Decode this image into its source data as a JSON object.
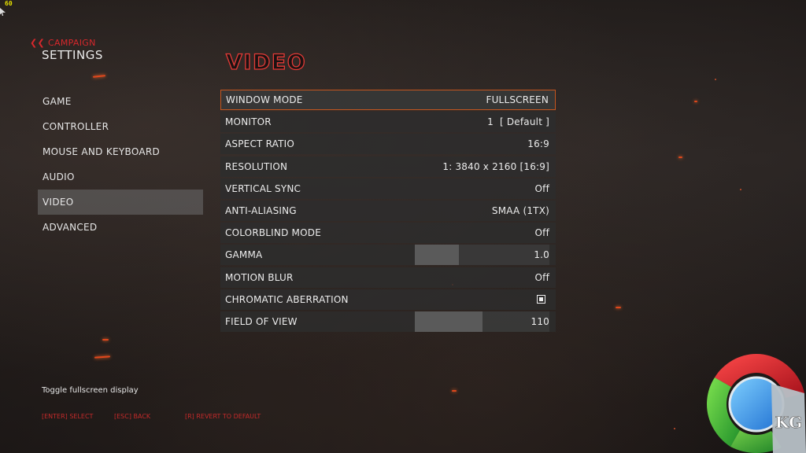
{
  "hud": {
    "fps": "60"
  },
  "header": {
    "back_label": "CAMPAIGN",
    "section_title": "SETTINGS",
    "page_title": "VIDEO"
  },
  "sidebar": {
    "items": [
      {
        "label": "GAME",
        "active": false
      },
      {
        "label": "CONTROLLER",
        "active": false
      },
      {
        "label": "MOUSE AND KEYBOARD",
        "active": false
      },
      {
        "label": "AUDIO",
        "active": false
      },
      {
        "label": "VIDEO",
        "active": true
      },
      {
        "label": "ADVANCED",
        "active": false
      }
    ]
  },
  "settings": [
    {
      "label": "WINDOW MODE",
      "value": "FULLSCREEN",
      "type": "select",
      "selected": true
    },
    {
      "label": "MONITOR",
      "value": "1  [ Default ]",
      "type": "select"
    },
    {
      "label": "ASPECT RATIO",
      "value": "16:9",
      "type": "select"
    },
    {
      "label": "RESOLUTION",
      "value": "1: 3840 x 2160 [16:9]",
      "type": "select"
    },
    {
      "label": "VERTICAL SYNC",
      "value": "Off",
      "type": "select"
    },
    {
      "label": "ANTI-ALIASING",
      "value": "SMAA (1TX)",
      "type": "select"
    },
    {
      "label": "COLORBLIND MODE",
      "value": "Off",
      "type": "select"
    },
    {
      "label": "GAMMA",
      "value": "1.0",
      "type": "slider",
      "level": 0.33
    },
    {
      "label": "MOTION BLUR",
      "value": "Off",
      "type": "select"
    },
    {
      "label": "CHROMATIC ABERRATION",
      "value": "",
      "type": "checkbox",
      "checked": true
    },
    {
      "label": "FIELD OF VIEW",
      "value": "110",
      "type": "slider",
      "level": 0.5
    }
  ],
  "footer": {
    "description": "Toggle fullscreen display",
    "hints": {
      "select": "[ENTER] SELECT",
      "back": "[ESC] BACK",
      "revert": "[R] REVERT TO DEFAULT"
    }
  },
  "watermark": {
    "text": "KG",
    "icon": "kitguru-logo"
  },
  "colors": {
    "accent": "#e33a36",
    "selection_border": "#c4561f",
    "hint": "#c42a2a"
  }
}
